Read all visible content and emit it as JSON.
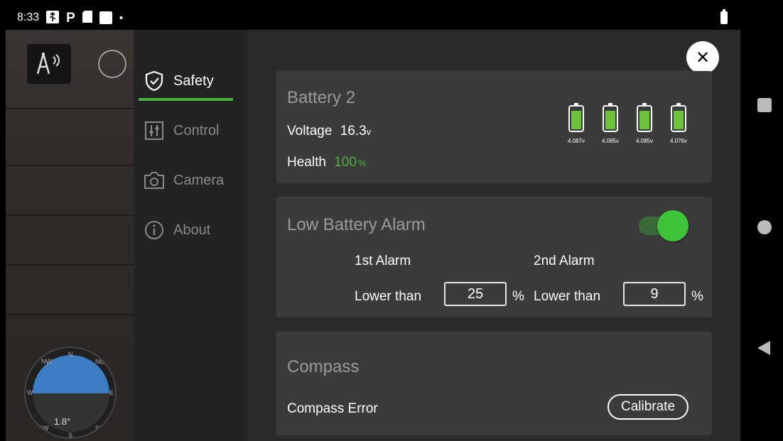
{
  "status_bar": {
    "time": "8:33",
    "icons": [
      "usb-icon",
      "parking-icon",
      "sd-card-icon",
      "screenshot-icon",
      "dot-icon"
    ],
    "battery": "battery-icon"
  },
  "camera_feed": {
    "attitude_tilt": "1.8°",
    "compass_labels": [
      "NW",
      "N",
      "NE",
      "W",
      "E",
      "SW",
      "S",
      "SE"
    ]
  },
  "menu": {
    "items": [
      {
        "label": "Safety",
        "icon": "shield-check-icon",
        "active": true
      },
      {
        "label": "Control",
        "icon": "sliders-icon",
        "active": false
      },
      {
        "label": "Camera",
        "icon": "camera-icon",
        "active": false
      },
      {
        "label": "About",
        "icon": "info-icon",
        "active": false
      }
    ]
  },
  "battery": {
    "title": "Battery 2",
    "voltage_label": "Voltage",
    "voltage_value": "16.3",
    "voltage_unit": "v",
    "health_label": "Health",
    "health_value": "100",
    "health_unit": "%",
    "cells": [
      {
        "voltage": "4.087",
        "unit": "v",
        "level": 0.85
      },
      {
        "voltage": "4.085",
        "unit": "v",
        "level": 0.85
      },
      {
        "voltage": "4.085",
        "unit": "v",
        "level": 0.85
      },
      {
        "voltage": "4.076",
        "unit": "v",
        "level": 0.85
      }
    ]
  },
  "low_battery_alarm": {
    "title": "Low Battery Alarm",
    "enabled": true,
    "first": {
      "label": "1st Alarm",
      "prefix": "Lower than",
      "value": "25",
      "unit": "%"
    },
    "second": {
      "label": "2nd Alarm",
      "prefix": "Lower than",
      "value": "9",
      "unit": "%"
    }
  },
  "compass": {
    "title": "Compass",
    "status_label": "Compass Error",
    "calibrate_label": "Calibrate"
  },
  "colors": {
    "accent_green": "#4caf3f",
    "battery_fill": "#6dc13b",
    "toggle_on": "#3ec43a",
    "card_bg": "#3b3b3b",
    "panel_bg": "#2b2b2b",
    "menu_bg": "#232323"
  }
}
